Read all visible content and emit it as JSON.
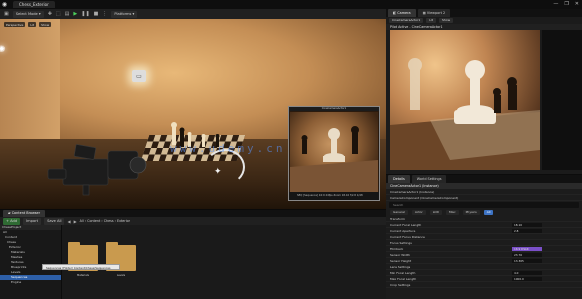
{
  "window": {
    "tab_title": "Chess_Exterior",
    "controls": [
      "—",
      "❐",
      "✕"
    ]
  },
  "toolbar": {
    "select_mode": "Select Mode",
    "platforms": "Platforms",
    "play_icon": "play-icon"
  },
  "viewport": {
    "chips": [
      "Perspective",
      "Lit",
      "Show"
    ],
    "pip_title": "CineCameraActor1",
    "pip_footer": "SEQ [Sequence] 16:9 24fps Zoom 18.10 f/2.8 1/48"
  },
  "watermark": "www.udemy.cn",
  "camera_panel": {
    "tabs": [
      "Camera",
      "Viewport 2"
    ],
    "tab_icons": [
      "camera-icon",
      "grid-icon"
    ],
    "chips": [
      "CineCameraActor1",
      "Lit",
      "Show"
    ],
    "subtitle": "Pilot Active - CineCameraActor1"
  },
  "details": {
    "tabs": [
      "Details",
      "World Settings"
    ],
    "header": "CineCameraActor1 (Instance)",
    "components": [
      "CineCameraActor1 (Instance)",
      "CameraComponent (CineCameraComponent)"
    ],
    "search_placeholder": "Search",
    "categories": [
      "General",
      "Actor",
      "LOD",
      "Misc",
      "Physics",
      "All"
    ],
    "active_category": "All",
    "rows": [
      {
        "label": "Transform",
        "value": ""
      },
      {
        "label": "Current Focal Length",
        "value": "18.10"
      },
      {
        "label": "Current Aperture",
        "value": "2.8"
      },
      {
        "label": "Current Focus Distance",
        "value": ""
      },
      {
        "label": "Focus Settings",
        "value": ""
      },
      {
        "label": "Filmback",
        "value": "16:9 DSLR",
        "highlight": true
      },
      {
        "label": "Sensor Width",
        "value": "23.76"
      },
      {
        "label": "Sensor Height",
        "value": "13.365"
      },
      {
        "label": "Lens Settings",
        "value": ""
      },
      {
        "label": "Min Focal Length",
        "value": "4.0"
      },
      {
        "label": "Max Focal Length",
        "value": "1000.0"
      },
      {
        "label": "Crop Settings",
        "value": ""
      }
    ]
  },
  "content_browser": {
    "tab": "Content Browser",
    "add_label": "+ Add",
    "import_label": "Import",
    "save_all_label": "Save All",
    "path": [
      "All",
      "Content",
      "Chess",
      "Exterior"
    ],
    "tree_root": "ChessProject",
    "tree": [
      "All",
      "Content",
      "Chess",
      "Exterior",
      "Materials",
      "Meshes",
      "Textures",
      "Blueprints",
      "Levels",
      "Sequences",
      "Engine"
    ],
    "selected_tree": "Sequences",
    "folders": [
      "Materials",
      "Levels"
    ],
    "tooltip": "Sequences (Folder)  Content/Chess/Sequences"
  }
}
